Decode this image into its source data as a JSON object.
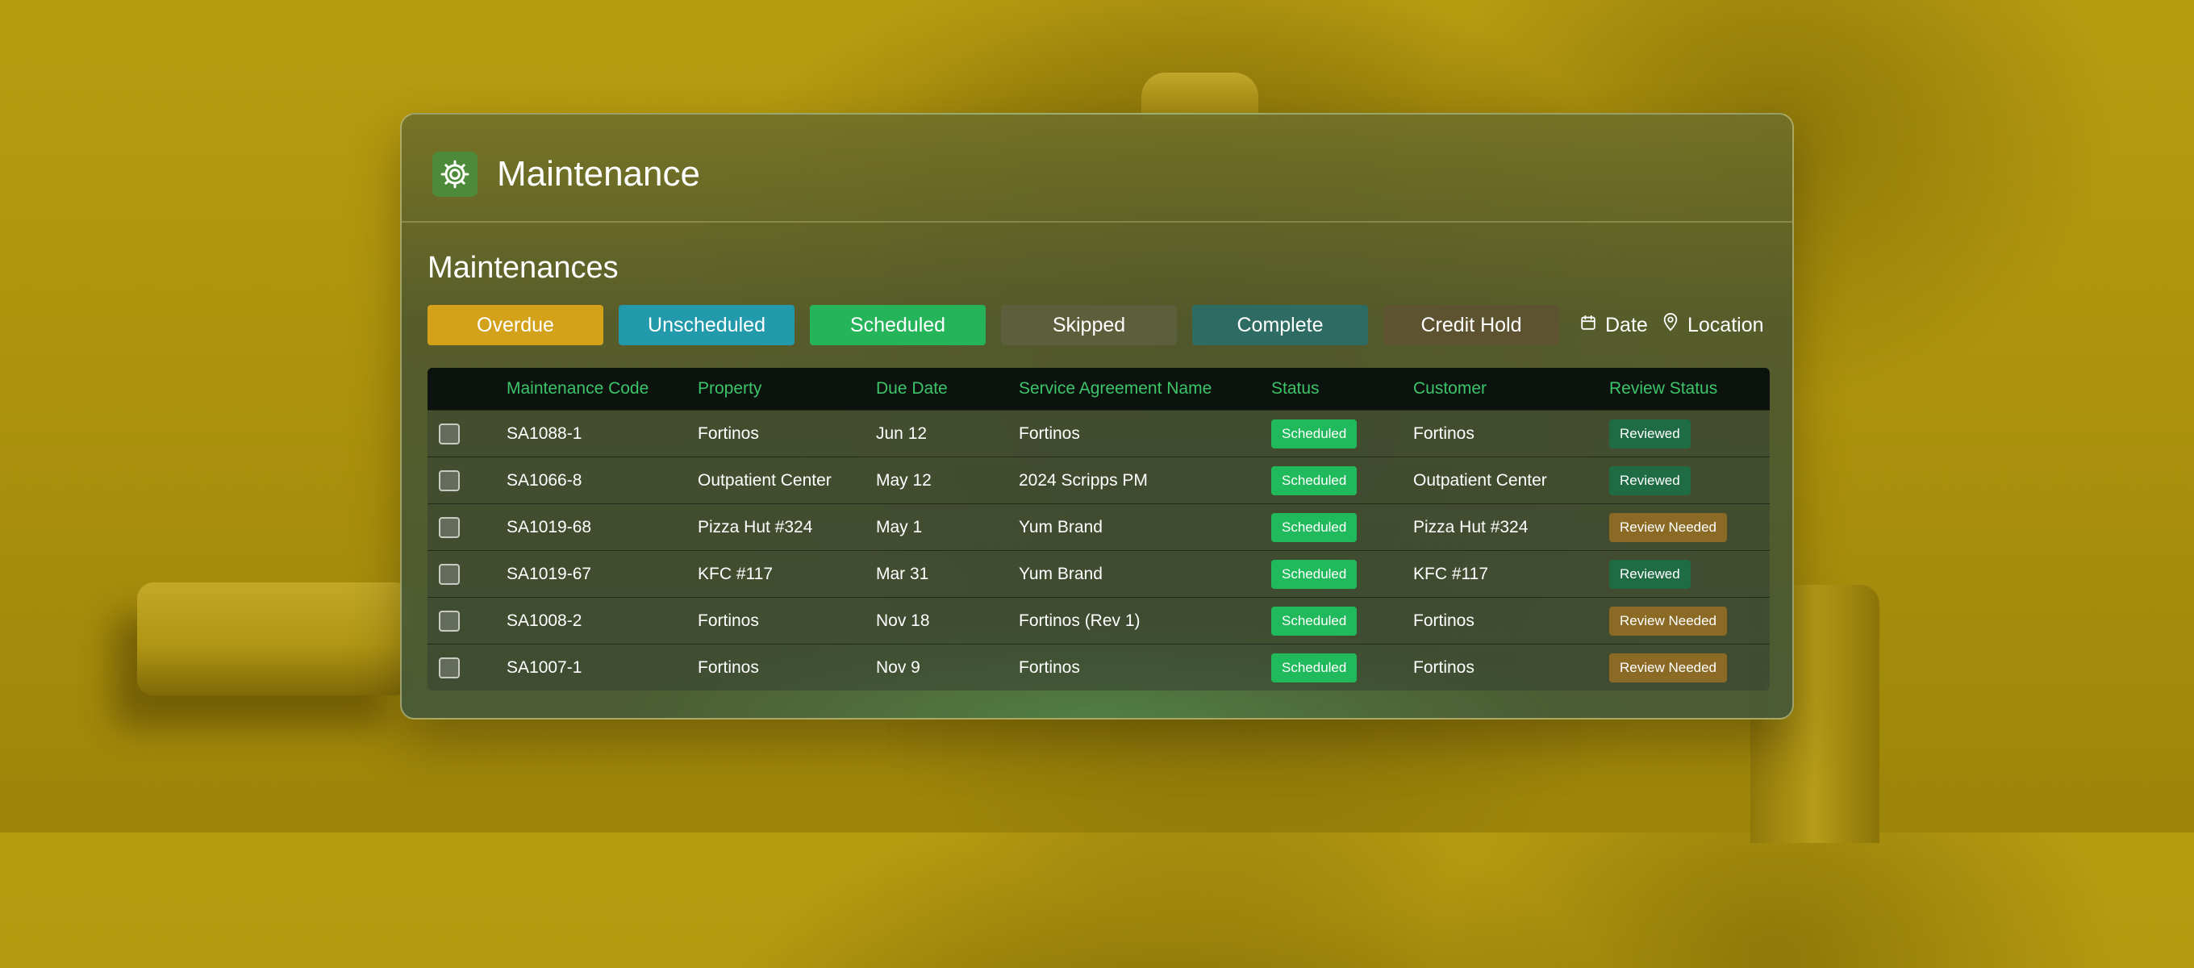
{
  "app": {
    "title": "Maintenance",
    "icon": "gear-icon"
  },
  "section": {
    "title": "Maintenances"
  },
  "filters": {
    "chips": [
      {
        "label": "Overdue",
        "color": "#d4a21a"
      },
      {
        "label": "Unscheduled",
        "color": "#239aac"
      },
      {
        "label": "Scheduled",
        "color": "#25b45a"
      },
      {
        "label": "Skipped",
        "color": "#5d5e3c"
      },
      {
        "label": "Complete",
        "color": "#2e6b63"
      },
      {
        "label": "Credit Hold",
        "color": "#5e5330"
      }
    ],
    "date_label": "Date",
    "location_label": "Location"
  },
  "table": {
    "headers": [
      "Maintenance Code",
      "Property",
      "Due Date",
      "Service Agreement Name",
      "Status",
      "Customer",
      "Review Status"
    ],
    "rows": [
      {
        "code": "SA1088-1",
        "property": "Fortinos",
        "due": "Jun 12",
        "agreement": "Fortinos",
        "status": "Scheduled",
        "customer": "Fortinos",
        "review": "Reviewed"
      },
      {
        "code": "SA1066-8",
        "property": "Outpatient Center",
        "due": "May 12",
        "agreement": "2024 Scripps PM",
        "status": "Scheduled",
        "customer": "Outpatient Center",
        "review": "Reviewed"
      },
      {
        "code": "SA1019-68",
        "property": "Pizza Hut #324",
        "due": "May 1",
        "agreement": "Yum Brand",
        "status": "Scheduled",
        "customer": "Pizza Hut #324",
        "review": "Review Needed"
      },
      {
        "code": "SA1019-67",
        "property": "KFC #117",
        "due": "Mar 31",
        "agreement": "Yum Brand",
        "status": "Scheduled",
        "customer": "KFC #117",
        "review": "Reviewed"
      },
      {
        "code": "SA1008-2",
        "property": "Fortinos",
        "due": "Nov 18",
        "agreement": "Fortinos (Rev 1)",
        "status": "Scheduled",
        "customer": "Fortinos",
        "review": "Review Needed"
      },
      {
        "code": "SA1007-1",
        "property": "Fortinos",
        "due": "Nov 9",
        "agreement": "Fortinos",
        "status": "Scheduled",
        "customer": "Fortinos",
        "review": "Review Needed"
      }
    ]
  }
}
